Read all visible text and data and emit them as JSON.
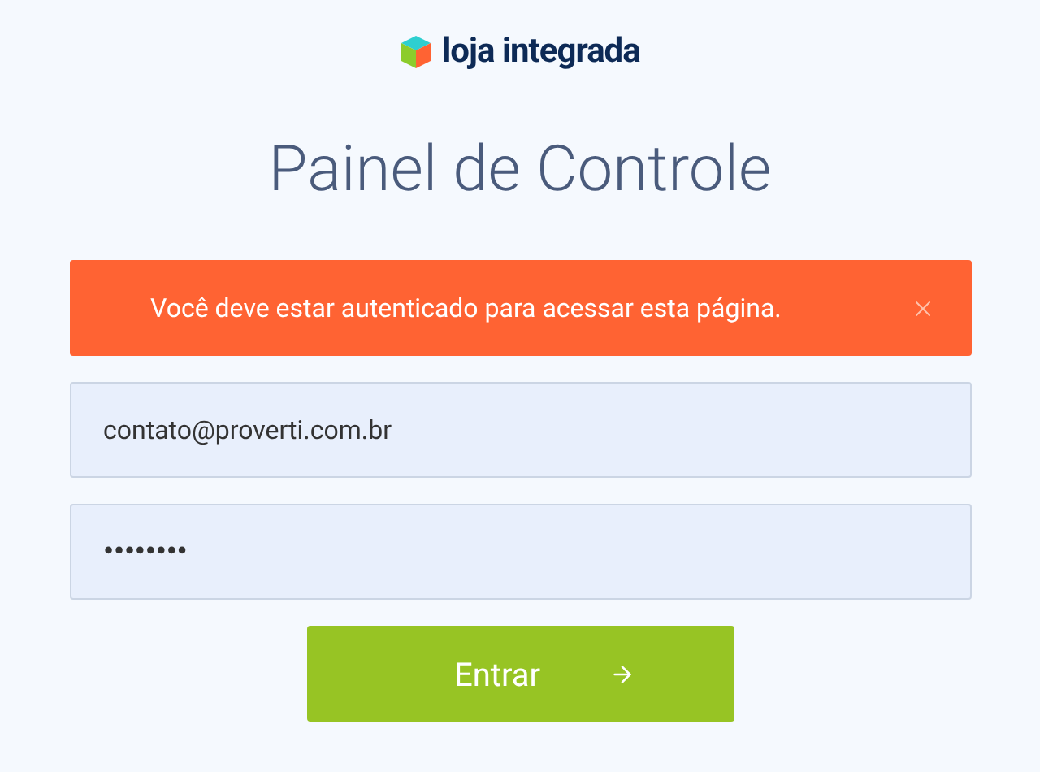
{
  "logo": {
    "text": "loja integrada"
  },
  "title": "Painel de Controle",
  "alert": {
    "message": "Você deve estar autenticado para acessar esta página."
  },
  "fields": [
    {
      "kind": "email",
      "value": "contato@proverti.com.br"
    },
    {
      "kind": "password",
      "value": "••••••••"
    }
  ],
  "submit": {
    "label": "Entrar"
  }
}
